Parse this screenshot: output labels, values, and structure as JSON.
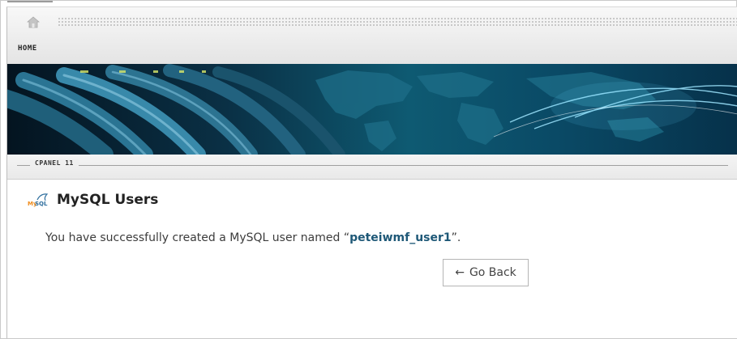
{
  "nav": {
    "home_label": "HOME"
  },
  "section": {
    "label": "CPANEL 11"
  },
  "page": {
    "title": "MySQL Users",
    "message_prefix": "You have successfully created a MySQL user named “",
    "username": "peteiwmf_user1",
    "message_suffix": "”.",
    "go_back_arrow": "←",
    "go_back_label": "Go Back"
  },
  "icons": {
    "home": "home-icon",
    "mysql": "mysql-logo-icon"
  },
  "colors": {
    "username": "#1e5877",
    "banner_dark": "#041420",
    "banner_light": "#0e5a72"
  }
}
